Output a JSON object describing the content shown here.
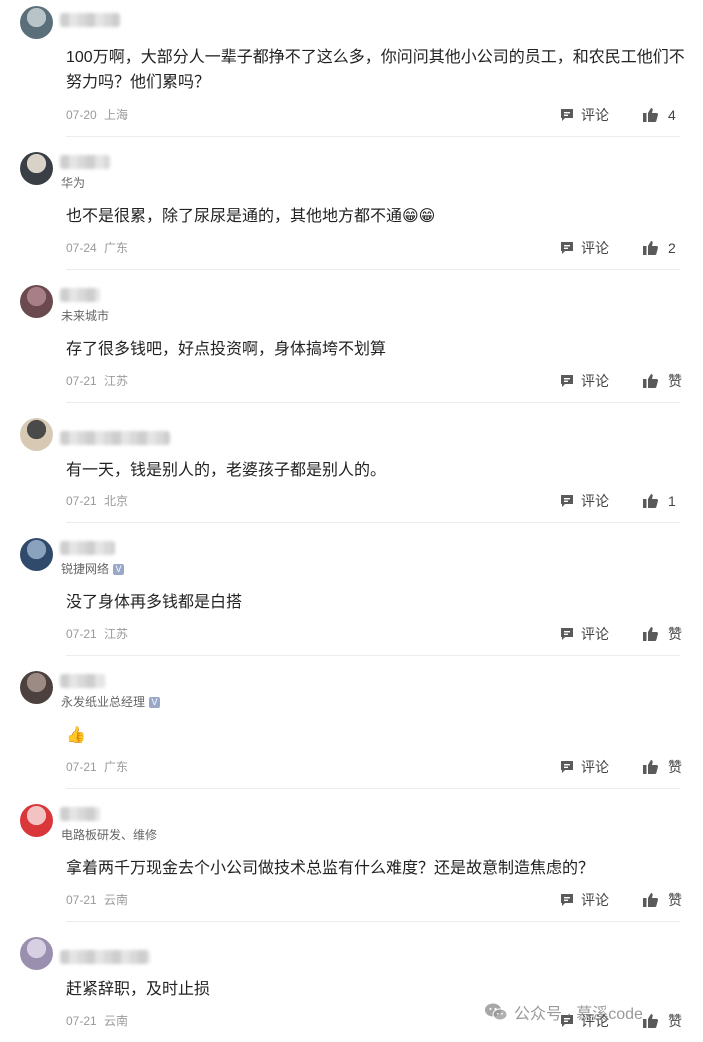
{
  "labels": {
    "reply": "评论",
    "like_empty": "赞"
  },
  "comments": [
    {
      "subtitle": "",
      "verified": false,
      "content": "100万啊，大部分人一辈子都挣不了这么多，你问问其他小公司的员工，和农民工他们不努力吗？他们累吗？",
      "date": "07-20",
      "location": "上海",
      "likes": "4",
      "avatar": [
        "#5b6f7a",
        "#b9c4c9"
      ]
    },
    {
      "subtitle": "华为",
      "verified": false,
      "content": "也不是很累，除了尿尿是通的，其他地方都不通😁😁",
      "date": "07-24",
      "location": "广东",
      "likes": "2",
      "avatar": [
        "#3a3f45",
        "#d8d2c8"
      ]
    },
    {
      "subtitle": "未来城市",
      "verified": false,
      "content": "存了很多钱吧，好点投资啊，身体搞垮不划算",
      "date": "07-21",
      "location": "江苏",
      "likes": "",
      "avatar": [
        "#6a4a4f",
        "#a87f86"
      ]
    },
    {
      "subtitle": "",
      "verified": false,
      "content": "有一天，钱是别人的，老婆孩子都是别人的。",
      "date": "07-21",
      "location": "北京",
      "likes": "1",
      "avatar": [
        "#d8c9b5",
        "#4a4a4a"
      ]
    },
    {
      "subtitle": "锐捷网络",
      "verified": true,
      "content": "没了身体再多钱都是白搭",
      "date": "07-21",
      "location": "江苏",
      "likes": "",
      "avatar": [
        "#2f4a6a",
        "#8aa2bd"
      ]
    },
    {
      "subtitle": "永发纸业总经理",
      "verified": true,
      "content": "👍",
      "date": "07-21",
      "location": "广东",
      "likes": "",
      "avatar": [
        "#4d4140",
        "#9b8b84"
      ]
    },
    {
      "subtitle": "电路板研发、维修",
      "verified": false,
      "content": "拿着两千万现金去个小公司做技术总监有什么难度？还是故意制造焦虑的？",
      "date": "07-21",
      "location": "云南",
      "likes": "",
      "avatar": [
        "#d9373a",
        "#f3c2c2"
      ]
    },
    {
      "subtitle": "",
      "verified": false,
      "content": "赶紧辞职，及时止损",
      "date": "07-21",
      "location": "云南",
      "likes": "",
      "avatar": [
        "#9a8fae",
        "#d7cfe2"
      ]
    }
  ],
  "watermark": {
    "label": "公众号 · 慕溪code"
  }
}
